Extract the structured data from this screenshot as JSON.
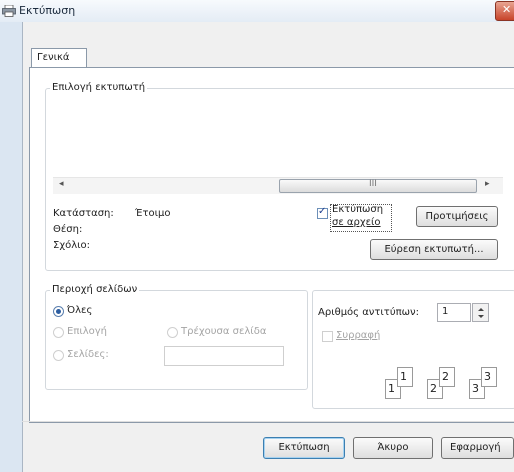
{
  "window": {
    "title": "Εκτύπωση",
    "close_glyph": "✕"
  },
  "tabs": [
    {
      "label": "Γενικά",
      "selected": true
    }
  ],
  "printer_group": {
    "legend": "Επιλογή εκτυπωτή",
    "scroll_left": "◂",
    "scroll_grip": "III",
    "scroll_right": "▸",
    "status_label": "Κατάσταση:",
    "status_value": "Έτοιμο",
    "location_label": "Θέση:",
    "comment_label": "Σχόλιο:",
    "print_to_file_line1": "Εκτύπωση",
    "print_to_file_line2": "σε αρχείο",
    "print_to_file_checked": true,
    "preferences_button": "Προτιμήσεις",
    "find_printer_button": "Εύρεση εκτυπωτή..."
  },
  "range_group": {
    "legend": "Περιοχή σελίδων",
    "all": "Όλες",
    "selection": "Επιλογή",
    "current_page": "Τρέχουσα σελίδα",
    "pages": "Σελίδες:",
    "pages_value": ""
  },
  "copies": {
    "label": "Αριθμός αντιτύπων:",
    "value": "1",
    "collate": "Συρραφή",
    "collate_checked": false,
    "collate_pages": [
      {
        "back": "1",
        "front": "1"
      },
      {
        "back": "2",
        "front": "2"
      },
      {
        "back": "3",
        "front": "3"
      }
    ]
  },
  "buttons": {
    "print": "Εκτύπωση",
    "cancel": "Άκυρο",
    "apply": "Εφαρμογή"
  },
  "icons": {
    "title": "printer-icon",
    "check": "✓"
  },
  "colors": {
    "close_button": "#c8442a",
    "title_bar": "#e4ecf5",
    "frame": "#dbe6f2"
  }
}
